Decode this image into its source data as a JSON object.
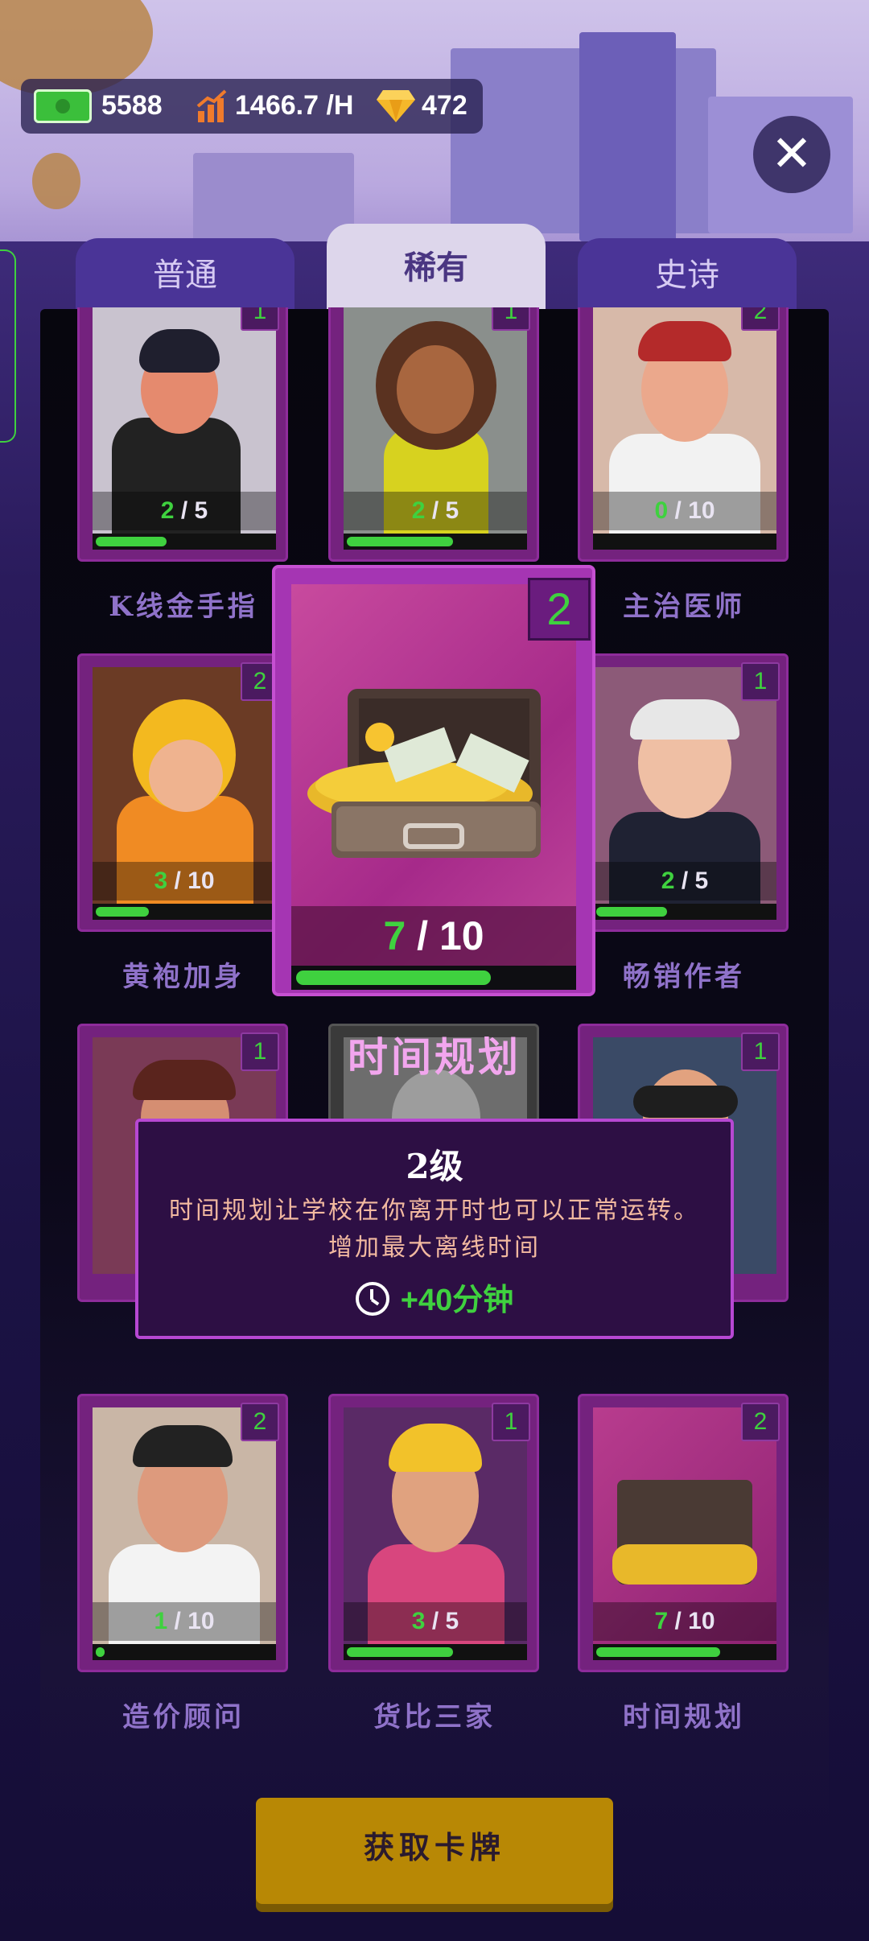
{
  "hud": {
    "cash": "5588",
    "income_rate": "1466.7 /H",
    "gems": "472"
  },
  "tabs": [
    {
      "label": "普通",
      "active": false
    },
    {
      "label": "稀有",
      "active": true
    },
    {
      "label": "史诗",
      "active": false
    }
  ],
  "cards": [
    {
      "name": "K线金手指",
      "level": "1",
      "have": "2",
      "need": "5",
      "progress": 0.4,
      "art": "businessman-icon"
    },
    {
      "name": "",
      "level": "1",
      "have": "2",
      "need": "5",
      "progress": 0.6,
      "art": "singer-icon"
    },
    {
      "name": "主治医师",
      "level": "2",
      "have": "0",
      "need": "10",
      "progress": 0.0,
      "art": "doctor-icon"
    },
    {
      "name": "黄袍加身",
      "level": "2",
      "have": "3",
      "need": "10",
      "progress": 0.3,
      "art": "courier-icon"
    },
    {
      "name": "畅销作者",
      "level": "1",
      "have": "2",
      "need": "5",
      "progress": 0.4,
      "art": "author-icon"
    },
    {
      "name": "",
      "level": "1",
      "have": "",
      "need": "",
      "progress": 0.0,
      "art": "salesman-icon"
    },
    {
      "name": "",
      "level": "",
      "have": "",
      "need": "",
      "progress": 0.0,
      "art": "advisor-icon"
    },
    {
      "name": "",
      "level": "1",
      "have": "",
      "need": "",
      "progress": 0.0,
      "art": "designer-icon"
    },
    {
      "name": "造价顾问",
      "level": "2",
      "have": "1",
      "need": "10",
      "progress": 0.05,
      "art": "consultant-icon"
    },
    {
      "name": "货比三家",
      "level": "1",
      "have": "3",
      "need": "5",
      "progress": 0.6,
      "art": "shopper-icon"
    },
    {
      "name": "时间规划",
      "level": "2",
      "have": "7",
      "need": "10",
      "progress": 0.7,
      "art": "money-briefcase-icon"
    }
  ],
  "featured": {
    "title": "时间规划",
    "level": "2",
    "have": "7",
    "need": "10",
    "progress": 0.7
  },
  "tooltip": {
    "level_label": "2级",
    "description_line1": "时间规划让学校在你离开时也可以正常运转。",
    "description_line2": "增加最大离线时间",
    "bonus": "+40分钟"
  },
  "draw_button": "获取卡牌",
  "colors": {
    "accent_green": "#3fd13f",
    "card_purple": "#74227e",
    "button_gold": "#b88805"
  }
}
